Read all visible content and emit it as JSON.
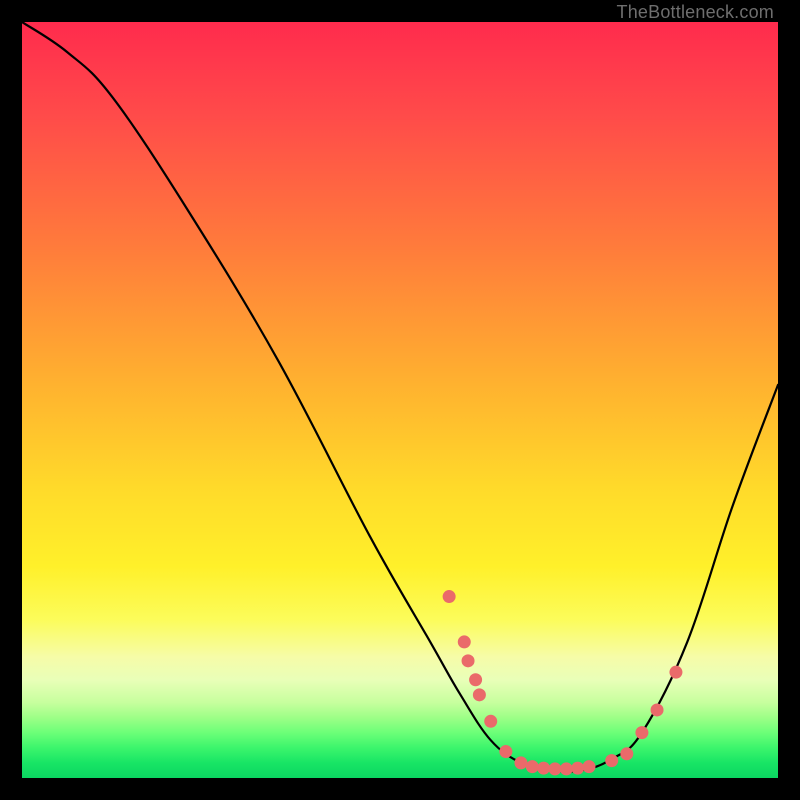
{
  "attribution": "TheBottleneck.com",
  "chart_data": {
    "type": "line",
    "title": "",
    "xlabel": "",
    "ylabel": "",
    "xlim": [
      0,
      100
    ],
    "ylim": [
      0,
      100
    ],
    "curve": [
      {
        "x": 0,
        "y": 100
      },
      {
        "x": 6,
        "y": 96
      },
      {
        "x": 12,
        "y": 90
      },
      {
        "x": 22,
        "y": 75
      },
      {
        "x": 34,
        "y": 55
      },
      {
        "x": 46,
        "y": 32
      },
      {
        "x": 54,
        "y": 18
      },
      {
        "x": 58,
        "y": 11
      },
      {
        "x": 62,
        "y": 5
      },
      {
        "x": 66,
        "y": 2
      },
      {
        "x": 70,
        "y": 1
      },
      {
        "x": 74,
        "y": 1
      },
      {
        "x": 78,
        "y": 2.5
      },
      {
        "x": 82,
        "y": 6
      },
      {
        "x": 88,
        "y": 18
      },
      {
        "x": 94,
        "y": 36
      },
      {
        "x": 100,
        "y": 52
      }
    ],
    "points": [
      {
        "x": 56.5,
        "y": 24
      },
      {
        "x": 58.5,
        "y": 18
      },
      {
        "x": 59,
        "y": 15.5
      },
      {
        "x": 60,
        "y": 13
      },
      {
        "x": 60.5,
        "y": 11
      },
      {
        "x": 62,
        "y": 7.5
      },
      {
        "x": 64,
        "y": 3.5
      },
      {
        "x": 66,
        "y": 2
      },
      {
        "x": 67.5,
        "y": 1.5
      },
      {
        "x": 69,
        "y": 1.3
      },
      {
        "x": 70.5,
        "y": 1.2
      },
      {
        "x": 72,
        "y": 1.2
      },
      {
        "x": 73.5,
        "y": 1.3
      },
      {
        "x": 75,
        "y": 1.5
      },
      {
        "x": 78,
        "y": 2.3
      },
      {
        "x": 80,
        "y": 3.2
      },
      {
        "x": 82,
        "y": 6
      },
      {
        "x": 84,
        "y": 9
      },
      {
        "x": 86.5,
        "y": 14
      }
    ]
  }
}
